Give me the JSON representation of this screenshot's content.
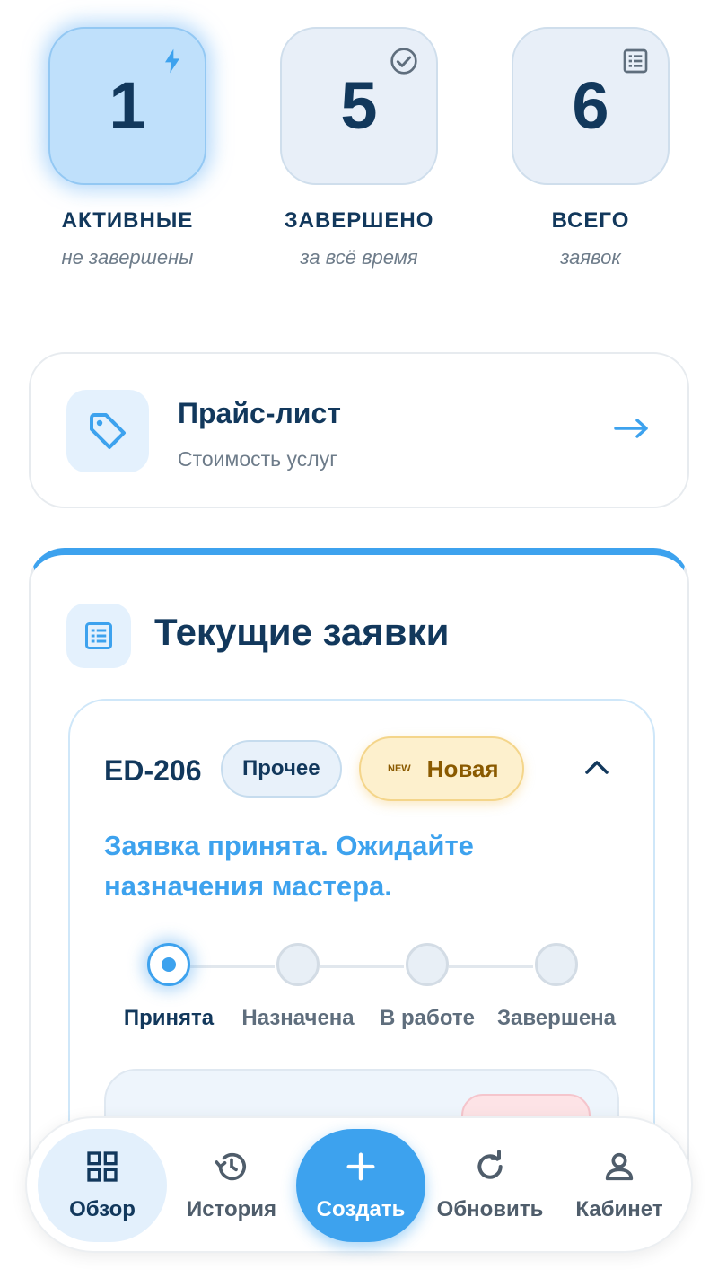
{
  "stats": [
    {
      "value": "1",
      "label": "АКТИВНЫЕ",
      "sub": "не завершены",
      "icon": "lightning-icon"
    },
    {
      "value": "5",
      "label": "ЗАВЕРШЕНО",
      "sub": "за всё время",
      "icon": "check-circle-icon"
    },
    {
      "value": "6",
      "label": "ВСЕГО",
      "sub": "заявок",
      "icon": "list-icon"
    }
  ],
  "price_list": {
    "title": "Прайс-лист",
    "subtitle": "Стоимость услуг",
    "icon": "tag-icon",
    "arrow_icon": "arrow-right-icon"
  },
  "requests": {
    "title": "Текущие заявки",
    "icon": "list-icon",
    "order": {
      "id": "ED-206",
      "category": "Прочее",
      "status_mark": "NEW",
      "status": "Новая",
      "message": "Заявка принята. Ожидайте назначения мастера.",
      "steps": [
        "Принята",
        "Назначена",
        "В работе",
        "Завершена"
      ],
      "current_step": 0
    }
  },
  "nav": {
    "items": [
      {
        "label": "Обзор",
        "icon": "grid-icon"
      },
      {
        "label": "История",
        "icon": "history-icon"
      },
      {
        "label": "Создать",
        "icon": "plus-icon"
      },
      {
        "label": "Обновить",
        "icon": "refresh-icon"
      },
      {
        "label": "Кабинет",
        "icon": "user-icon"
      }
    ],
    "selected": 0
  },
  "colors": {
    "accent": "#3da2ee",
    "text_dark": "#12385c",
    "text_muted": "#6e7c8a",
    "new_badge_bg": "#fdf0cd",
    "new_badge_text": "#8a5a00"
  }
}
